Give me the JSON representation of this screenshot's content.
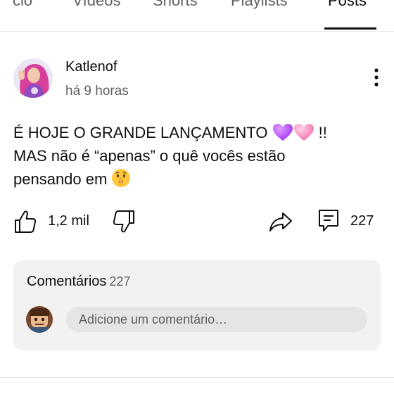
{
  "tabs": [
    {
      "label": "cio"
    },
    {
      "label": "Vídeos"
    },
    {
      "label": "Shorts"
    },
    {
      "label": "Playlists"
    },
    {
      "label": "Posts"
    }
  ],
  "active_tab": "Posts",
  "post": {
    "author": "Katlenof",
    "time": "há 9 horas",
    "text_line1": "É HOJE O GRANDE LANÇAMENTO ",
    "text_line1_end": " !!",
    "text_line2": "MAS não é “apenas” o quê vocês estão",
    "text_line3": "pensando em ",
    "emojis": [
      "purple-heart",
      "pink-heart",
      "shushing-face"
    ],
    "likes": "1,2 mil",
    "comments": "227"
  },
  "comments_section": {
    "title": "Comentários",
    "count": "227",
    "input_placeholder": "Adicione um comentário…"
  },
  "icons": {
    "more": "vertical-dots-icon",
    "like": "thumbs-up-icon",
    "dislike": "thumbs-down-icon",
    "share": "share-arrow-icon",
    "comment": "comment-icon"
  },
  "colors": {
    "text_primary": "#0f0f0f",
    "text_secondary": "#606060",
    "card_bg": "#f2f2f2",
    "input_bg": "#e5e5e5",
    "divider": "#e5e5e5"
  }
}
